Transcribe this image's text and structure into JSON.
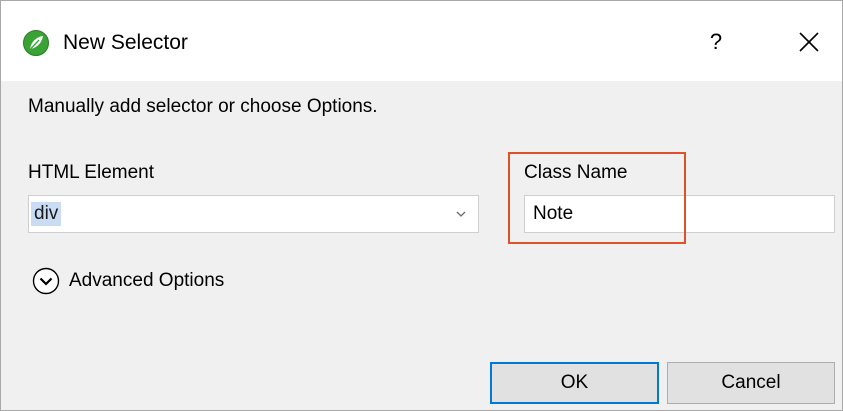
{
  "window": {
    "title": "New Selector",
    "help_label": "?",
    "close_icon": "close-icon",
    "app_icon": "leaf-icon"
  },
  "instruction": "Manually add selector or choose Options.",
  "html_element": {
    "label": "HTML Element",
    "value": "div",
    "dropdown_icon": "chevron-down-icon"
  },
  "class_name": {
    "label": "Class Name",
    "value": "Note",
    "highlight_color": "#e2502a"
  },
  "advanced_options": {
    "label": "Advanced Options",
    "icon": "circle-chevron-down-icon"
  },
  "buttons": {
    "ok_label": "OK",
    "cancel_label": "Cancel"
  },
  "colors": {
    "accent": "#0078d7",
    "selection": "#c9dcf3",
    "app_icon_green": "#3aa335",
    "dialog_bg": "#f0f0f0"
  }
}
